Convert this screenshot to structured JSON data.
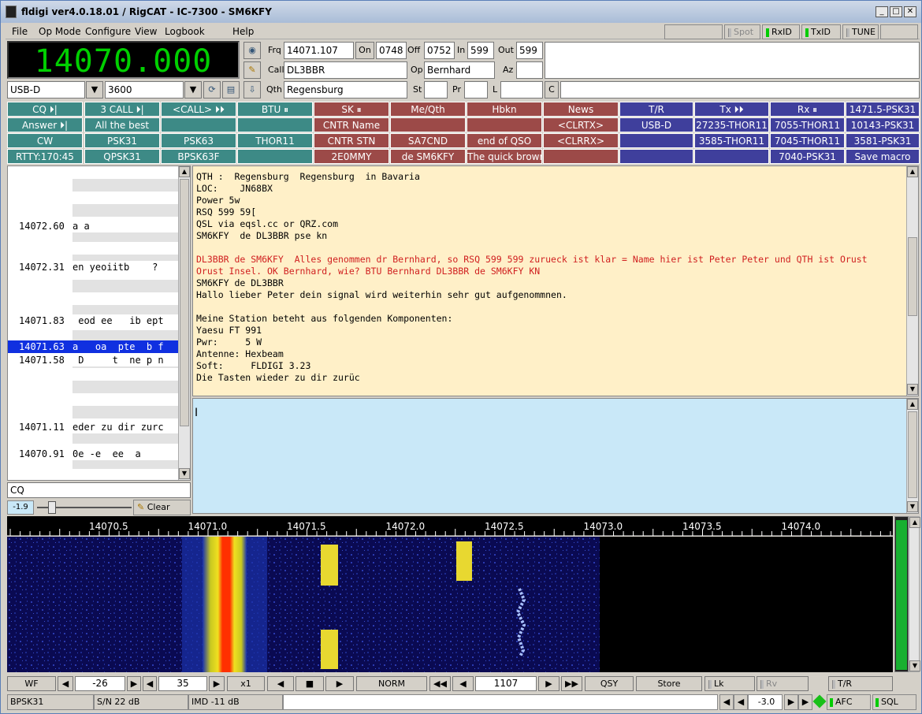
{
  "window": {
    "title": "fldigi ver4.0.18.01 / RigCAT - IC-7300 - SM6KFY"
  },
  "menu": {
    "file": "File",
    "opmode": "Op Mode",
    "configure": "Configure",
    "view": "View",
    "logbook": "Logbook",
    "help": "Help"
  },
  "header_buttons": {
    "spot": "Spot",
    "rxid": "RxID",
    "txid": "TxID",
    "tune": "TUNE"
  },
  "rig": {
    "frequency": "14070.000",
    "mode": "USB-D",
    "bandwidth": "3600"
  },
  "log": {
    "frq_label": "Frq",
    "frq": "14071.107",
    "on_label": "On",
    "on": "0748",
    "off_label": "Off",
    "off": "0752",
    "in_label": "In",
    "in": "599",
    "out_label": "Out",
    "out": "599",
    "call_label": "Call",
    "call": "DL3BBR",
    "op_label": "Op",
    "op": "Bernhard",
    "az_label": "Az",
    "az": "",
    "qth_label": "Qth",
    "qth": "Regensburg",
    "st_label": "St",
    "st": "",
    "pr_label": "Pr",
    "pr": "",
    "l_label": "L",
    "l": "",
    "c_label": "C",
    "notes": ""
  },
  "macros": {
    "row1": [
      "CQ ⏵|",
      "3  CALL ⏵|",
      "<CALL> ⏵⏵",
      "BTU ⏸",
      "SK ⏸",
      "Me/Qth",
      "Hbkn",
      "News",
      "T/R",
      "Tx ⏵⏵",
      "Rx ⏸",
      "1471.5-PSK31"
    ],
    "row2": [
      "Answer ⏵|",
      "All the best",
      "",
      "",
      "CNTR Name",
      "",
      "",
      "<CLRTX>",
      "USB-D",
      "27235-THOR11",
      "7055-THOR11",
      "10143-PSK31"
    ],
    "row3": [
      "CW",
      "PSK31",
      "PSK63",
      "THOR11",
      "CNTR  STN",
      "SA7CND",
      "end of QSO",
      "<CLRRX>",
      "",
      "3585-THOR11",
      "7045-THOR11",
      "3581-PSK31"
    ],
    "row4": [
      "RTTY:170:45",
      "QPSK31",
      "BPSK63F",
      "",
      "2E0MMY",
      "de SM6KFY",
      "The quick brown",
      "",
      "",
      "",
      "7040-PSK31",
      "Save macro"
    ]
  },
  "browser": {
    "rows": [
      {
        "freq": "14072.60",
        "text": "a a"
      },
      {
        "freq": "14072.31",
        "text": "en yeoiitb    ?"
      },
      {
        "freq": "14071.83",
        "text": " eod ee   ib ept"
      },
      {
        "freq": "14071.63",
        "text": "a   oa  pte  b f"
      },
      {
        "freq": "14071.58",
        "text": " D     t  ne p n"
      },
      {
        "freq": "14071.11",
        "text": "eder zu dir zurc"
      },
      {
        "freq": "14070.91",
        "text": "0e -e  ee  a"
      }
    ],
    "search": "CQ",
    "squelch": "-1.9",
    "clear_label": "Clear"
  },
  "rx_lines": [
    "QTH :  Regensburg  Regensburg  in Bavaria",
    "LOC:    JN68BX",
    "Power 5w",
    "RSQ 599 59[",
    "QSL via eqsl.cc or QRZ.com",
    "SM6KFY  de DL3BBR pse kn",
    "",
    "DL3BBR de SM6KFY  Alles genommen dr Bernhard, so RSQ 599 599 zurueck ist klar = Name hier ist Peter Peter und QTH ist Orust",
    "Orust Insel. OK Bernhard, wie? BTU Bernhard DL3BBR de SM6KFY KN",
    "SM6KFY de DL3BBR",
    "Hallo lieber Peter dein signal wird weiterhin sehr gut aufgenommnen.",
    "",
    "Meine Station beteht aus folgenden Komponenten:",
    "Yaesu FT 991",
    "Pwr:     5 W",
    "Antenne: Hexbeam",
    "Soft:     FLDIGI 3.23",
    "Die Tasten wieder zu dir zurüc"
  ],
  "colors": {
    "rx_bg": "#fff0c8",
    "tx_bg": "#c9e8f8",
    "tx_text": "#d02020",
    "freq_digits": "#00d000",
    "macro_teal": "#3d8a86",
    "macro_brown": "#9c4a48",
    "macro_navy": "#3f3f9c"
  },
  "scale": [
    "14070.5",
    "14071.0",
    "14071.5",
    "14072.0",
    "14072.5",
    "14073.0",
    "14073.5",
    "14074.0"
  ],
  "waterfall_controls": {
    "wf": "WF",
    "level": "-26",
    "range": "35",
    "zoom": "x1",
    "mode": "NORM",
    "carrier": "1107",
    "qsy": "QSY",
    "store": "Store",
    "lk": "Lk",
    "rv": "Rv",
    "tr": "T/R"
  },
  "status": {
    "mode": "BPSK31",
    "sn": "S/N 22 dB",
    "imd": "IMD -11 dB",
    "msg": "",
    "afc_val": "-3.0",
    "afc": "AFC",
    "sql": "SQL"
  }
}
